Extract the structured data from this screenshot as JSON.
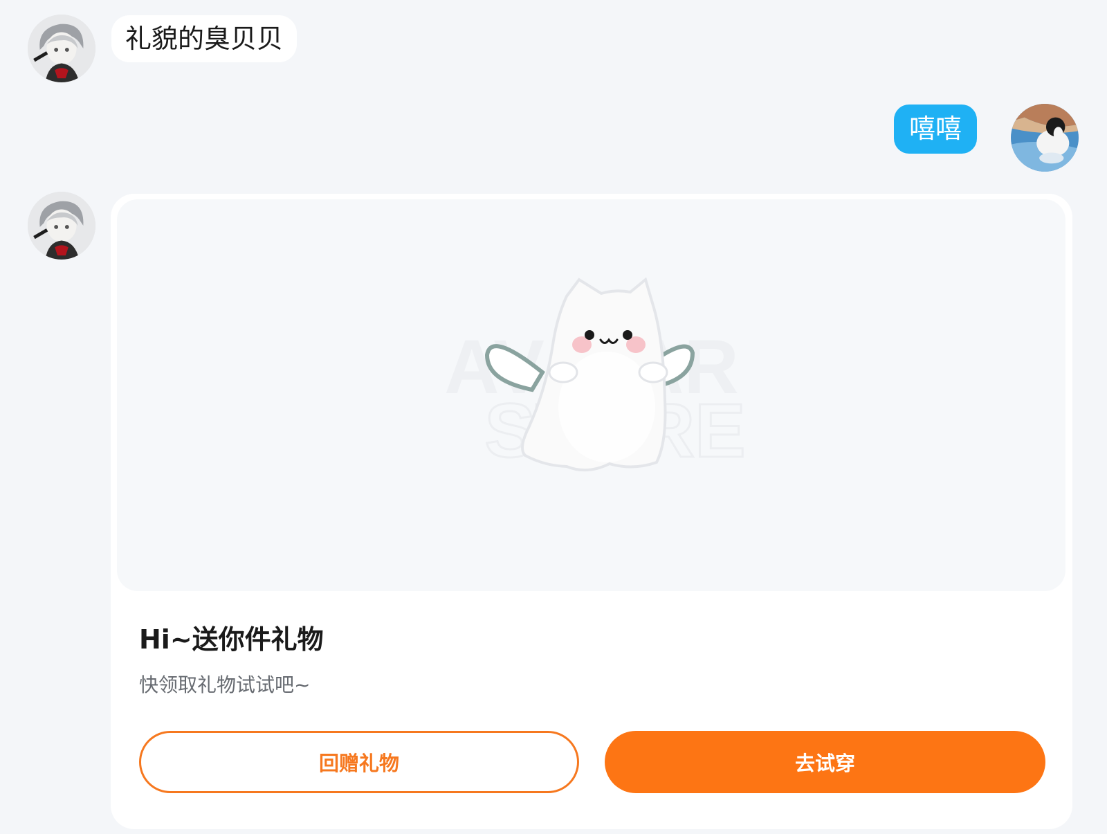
{
  "messages": {
    "incoming_text": "礼貌的臭贝贝",
    "outgoing_text": "嘻嘻"
  },
  "gift_card": {
    "title": "Hi~送你件礼物",
    "subtitle": "快领取礼物试试吧~",
    "return_gift_label": "回赠礼物",
    "try_on_label": "去试穿",
    "image_watermark": "AVATAR STORE"
  },
  "colors": {
    "page_bg": "#f4f6f9",
    "outgoing_bubble": "#1fb1f4",
    "accent_orange": "#fd7514"
  },
  "icons": {
    "incoming_avatar": "anime-avatar",
    "outgoing_avatar": "dog-photo-avatar",
    "gift_image": "white-ghost-cat-with-wings"
  }
}
